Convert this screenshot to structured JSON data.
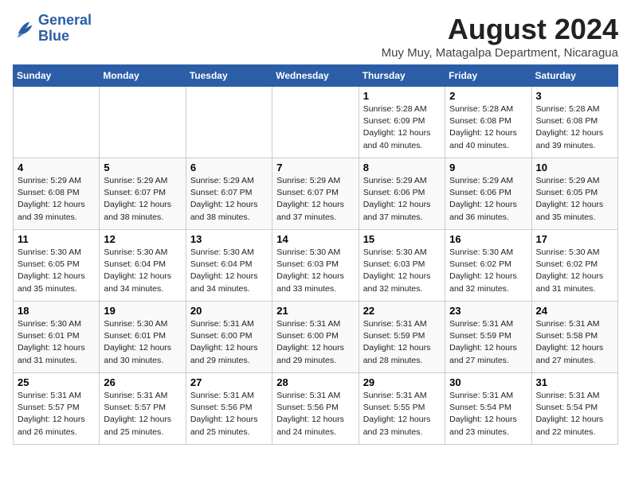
{
  "logo": {
    "line1": "General",
    "line2": "Blue"
  },
  "title": "August 2024",
  "subtitle": "Muy Muy, Matagalpa Department, Nicaragua",
  "days_of_week": [
    "Sunday",
    "Monday",
    "Tuesday",
    "Wednesday",
    "Thursday",
    "Friday",
    "Saturday"
  ],
  "weeks": [
    [
      {
        "day": "",
        "info": ""
      },
      {
        "day": "",
        "info": ""
      },
      {
        "day": "",
        "info": ""
      },
      {
        "day": "",
        "info": ""
      },
      {
        "day": "1",
        "info": "Sunrise: 5:28 AM\nSunset: 6:09 PM\nDaylight: 12 hours\nand 40 minutes."
      },
      {
        "day": "2",
        "info": "Sunrise: 5:28 AM\nSunset: 6:08 PM\nDaylight: 12 hours\nand 40 minutes."
      },
      {
        "day": "3",
        "info": "Sunrise: 5:28 AM\nSunset: 6:08 PM\nDaylight: 12 hours\nand 39 minutes."
      }
    ],
    [
      {
        "day": "4",
        "info": "Sunrise: 5:29 AM\nSunset: 6:08 PM\nDaylight: 12 hours\nand 39 minutes."
      },
      {
        "day": "5",
        "info": "Sunrise: 5:29 AM\nSunset: 6:07 PM\nDaylight: 12 hours\nand 38 minutes."
      },
      {
        "day": "6",
        "info": "Sunrise: 5:29 AM\nSunset: 6:07 PM\nDaylight: 12 hours\nand 38 minutes."
      },
      {
        "day": "7",
        "info": "Sunrise: 5:29 AM\nSunset: 6:07 PM\nDaylight: 12 hours\nand 37 minutes."
      },
      {
        "day": "8",
        "info": "Sunrise: 5:29 AM\nSunset: 6:06 PM\nDaylight: 12 hours\nand 37 minutes."
      },
      {
        "day": "9",
        "info": "Sunrise: 5:29 AM\nSunset: 6:06 PM\nDaylight: 12 hours\nand 36 minutes."
      },
      {
        "day": "10",
        "info": "Sunrise: 5:29 AM\nSunset: 6:05 PM\nDaylight: 12 hours\nand 35 minutes."
      }
    ],
    [
      {
        "day": "11",
        "info": "Sunrise: 5:30 AM\nSunset: 6:05 PM\nDaylight: 12 hours\nand 35 minutes."
      },
      {
        "day": "12",
        "info": "Sunrise: 5:30 AM\nSunset: 6:04 PM\nDaylight: 12 hours\nand 34 minutes."
      },
      {
        "day": "13",
        "info": "Sunrise: 5:30 AM\nSunset: 6:04 PM\nDaylight: 12 hours\nand 34 minutes."
      },
      {
        "day": "14",
        "info": "Sunrise: 5:30 AM\nSunset: 6:03 PM\nDaylight: 12 hours\nand 33 minutes."
      },
      {
        "day": "15",
        "info": "Sunrise: 5:30 AM\nSunset: 6:03 PM\nDaylight: 12 hours\nand 32 minutes."
      },
      {
        "day": "16",
        "info": "Sunrise: 5:30 AM\nSunset: 6:02 PM\nDaylight: 12 hours\nand 32 minutes."
      },
      {
        "day": "17",
        "info": "Sunrise: 5:30 AM\nSunset: 6:02 PM\nDaylight: 12 hours\nand 31 minutes."
      }
    ],
    [
      {
        "day": "18",
        "info": "Sunrise: 5:30 AM\nSunset: 6:01 PM\nDaylight: 12 hours\nand 31 minutes."
      },
      {
        "day": "19",
        "info": "Sunrise: 5:30 AM\nSunset: 6:01 PM\nDaylight: 12 hours\nand 30 minutes."
      },
      {
        "day": "20",
        "info": "Sunrise: 5:31 AM\nSunset: 6:00 PM\nDaylight: 12 hours\nand 29 minutes."
      },
      {
        "day": "21",
        "info": "Sunrise: 5:31 AM\nSunset: 6:00 PM\nDaylight: 12 hours\nand 29 minutes."
      },
      {
        "day": "22",
        "info": "Sunrise: 5:31 AM\nSunset: 5:59 PM\nDaylight: 12 hours\nand 28 minutes."
      },
      {
        "day": "23",
        "info": "Sunrise: 5:31 AM\nSunset: 5:59 PM\nDaylight: 12 hours\nand 27 minutes."
      },
      {
        "day": "24",
        "info": "Sunrise: 5:31 AM\nSunset: 5:58 PM\nDaylight: 12 hours\nand 27 minutes."
      }
    ],
    [
      {
        "day": "25",
        "info": "Sunrise: 5:31 AM\nSunset: 5:57 PM\nDaylight: 12 hours\nand 26 minutes."
      },
      {
        "day": "26",
        "info": "Sunrise: 5:31 AM\nSunset: 5:57 PM\nDaylight: 12 hours\nand 25 minutes."
      },
      {
        "day": "27",
        "info": "Sunrise: 5:31 AM\nSunset: 5:56 PM\nDaylight: 12 hours\nand 25 minutes."
      },
      {
        "day": "28",
        "info": "Sunrise: 5:31 AM\nSunset: 5:56 PM\nDaylight: 12 hours\nand 24 minutes."
      },
      {
        "day": "29",
        "info": "Sunrise: 5:31 AM\nSunset: 5:55 PM\nDaylight: 12 hours\nand 23 minutes."
      },
      {
        "day": "30",
        "info": "Sunrise: 5:31 AM\nSunset: 5:54 PM\nDaylight: 12 hours\nand 23 minutes."
      },
      {
        "day": "31",
        "info": "Sunrise: 5:31 AM\nSunset: 5:54 PM\nDaylight: 12 hours\nand 22 minutes."
      }
    ]
  ]
}
